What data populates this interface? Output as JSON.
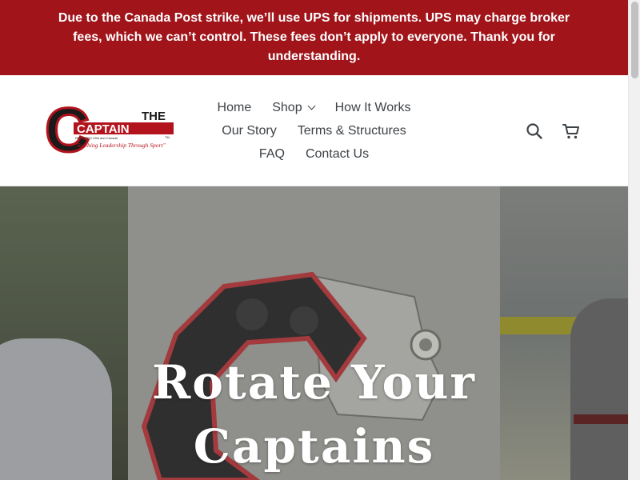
{
  "announcement": {
    "text": "Due to the Canada Post strike, we’ll use UPS for shipments. UPS may charge broker fees, which we can’t control. These fees don’t apply to everyone. Thank you for understanding."
  },
  "logo": {
    "letter": "C",
    "word_the": "THE",
    "word_captain": "CAPTAIN",
    "tm": "TM",
    "patent": "PATENTED USA and Canada",
    "tagline": "\"Teaching Leadership Through Sport\""
  },
  "nav": {
    "items": [
      {
        "label": "Home"
      },
      {
        "label": "Shop"
      },
      {
        "label": "How It Works"
      },
      {
        "label": "Our Story"
      },
      {
        "label": "Terms & Structures"
      },
      {
        "label": "FAQ"
      },
      {
        "label": "Contact Us"
      }
    ]
  },
  "header_icons": {
    "search": "search-icon",
    "cart": "cart-icon"
  },
  "hero": {
    "title_line1": "Rotate Your",
    "title_line2": "Captains"
  },
  "colors": {
    "announcement_bg": "#a0141a",
    "logo_red": "#b3131c",
    "logo_black": "#1a1a1a",
    "text": "#3d4246"
  }
}
